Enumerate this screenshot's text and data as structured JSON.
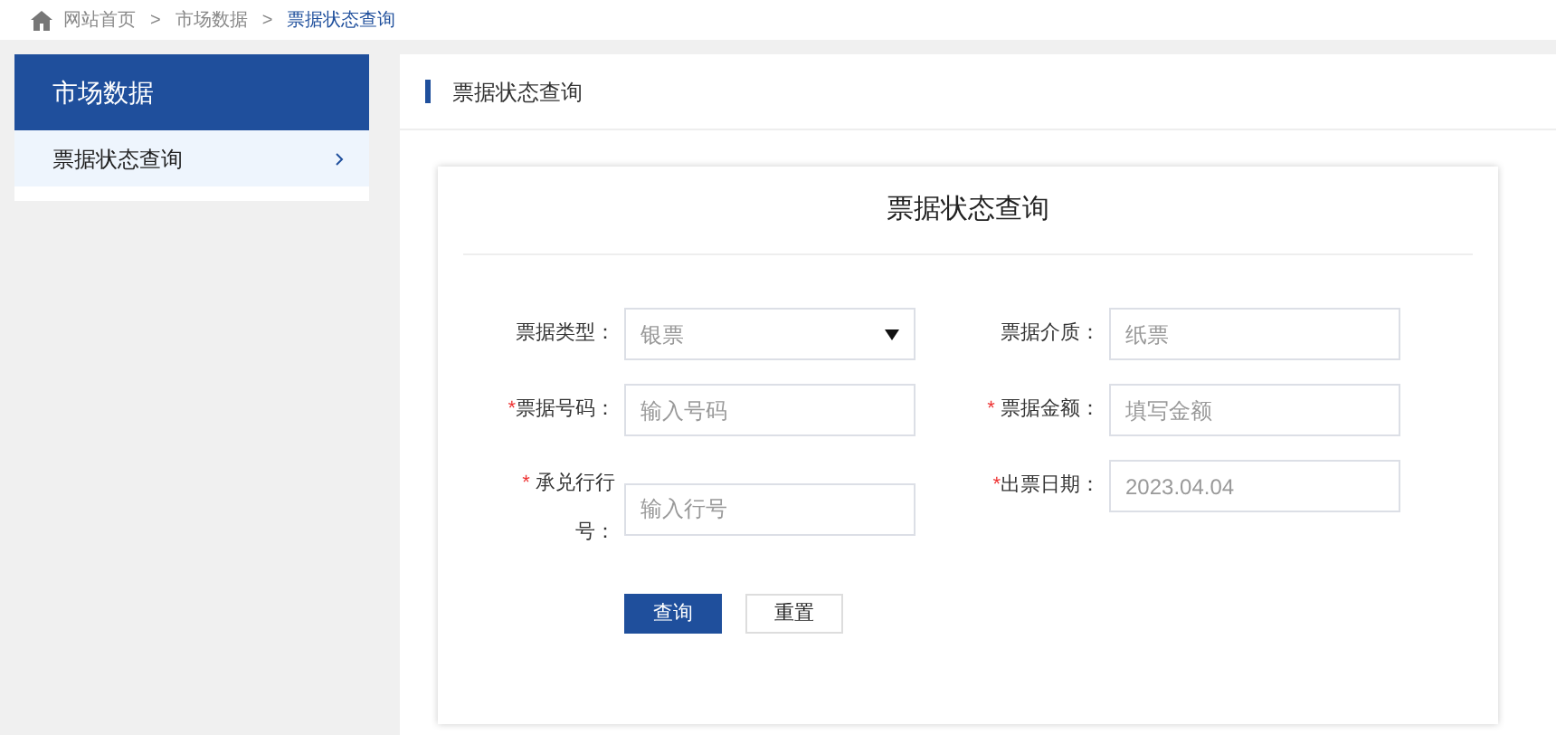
{
  "breadcrumb": {
    "separator": ">",
    "items": [
      "网站首页",
      "市场数据",
      "票据状态查询"
    ]
  },
  "sidebar": {
    "title": "市场数据",
    "items": [
      {
        "label": "票据状态查询",
        "selected": true
      }
    ]
  },
  "panel": {
    "title": "票据状态查询"
  },
  "form": {
    "title": "票据状态查询",
    "fields": [
      {
        "label": "票据类型：",
        "kind": "select",
        "value": "银票"
      },
      {
        "label": "票据介质：",
        "kind": "input",
        "placeholder": "纸票"
      },
      {
        "label": "票据号码：",
        "required_mark": "*",
        "kind": "input",
        "placeholder": "输入号码"
      },
      {
        "label": "票据金额：",
        "required_mark": "* ",
        "kind": "input",
        "placeholder": "填写金额"
      },
      {
        "label": "承兑行行号：",
        "required_mark": "* ",
        "kind": "input",
        "placeholder": "输入行号"
      },
      {
        "label": "出票日期：",
        "required_mark": "*",
        "kind": "input",
        "value": "2023.04.04"
      }
    ],
    "buttons": [
      {
        "label": "查询",
        "kind": "primary"
      },
      {
        "label": "重置",
        "kind": "secondary"
      }
    ]
  }
}
